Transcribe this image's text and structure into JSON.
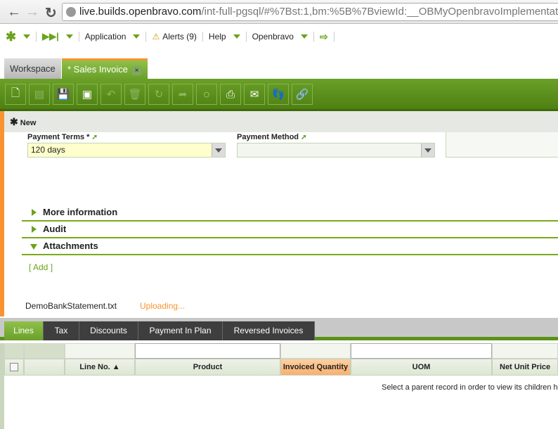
{
  "browser": {
    "url_host": "live.builds.openbravo.com",
    "url_rest": "/int-full-pgsql/#%7Bst:1,bm:%5B%7BviewId:__OBMyOpenbravoImplementation"
  },
  "menu": {
    "application": "Application",
    "alerts": "Alerts (9)",
    "help": "Help",
    "user": "Openbravo"
  },
  "tabs": {
    "workspace": "Workspace",
    "sales_invoice": "* Sales Invoice",
    "close": "×"
  },
  "status": {
    "new": "New"
  },
  "form": {
    "payment_terms_label": "Payment Terms *",
    "payment_terms_value": "120 days",
    "payment_method_label": "Payment Method",
    "payment_method_value": ""
  },
  "sections": {
    "more": "More information",
    "audit": "Audit",
    "attachments": "Attachments"
  },
  "attachments": {
    "add": "[ Add ]",
    "file": "DemoBankStatement.txt",
    "status": "Uploading..."
  },
  "child_tabs": [
    "Lines",
    "Tax",
    "Discounts",
    "Payment In Plan",
    "Reversed Invoices"
  ],
  "grid": {
    "columns": [
      "Line No. ▲",
      "Product",
      "Invoiced Quantity",
      "UOM",
      "Net Unit Price"
    ],
    "empty_message": "Select a parent record in order to view its children h"
  },
  "colors": {
    "green": "#6aa02a",
    "orange": "#f7942f"
  }
}
